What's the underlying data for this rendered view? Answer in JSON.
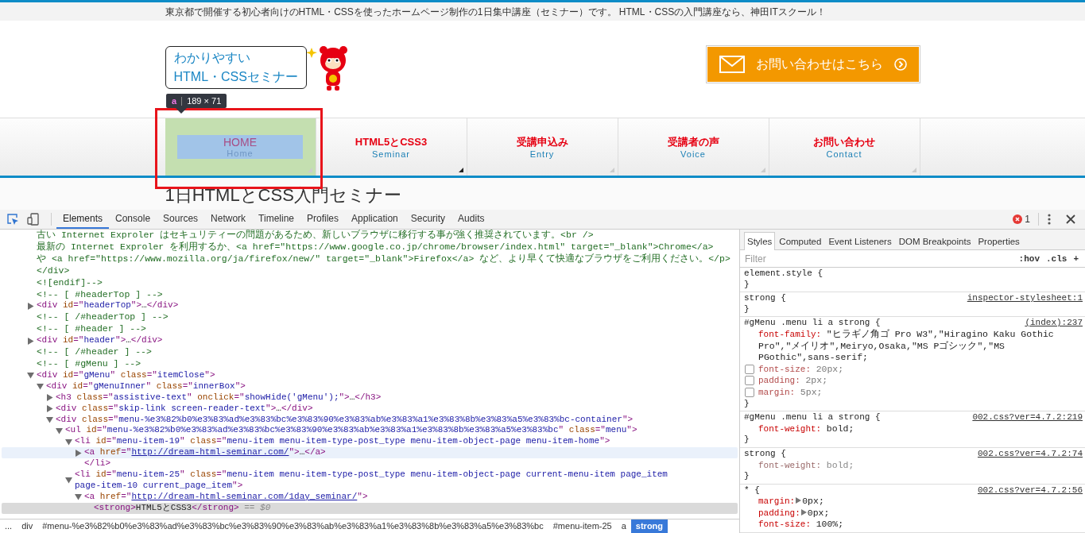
{
  "page": {
    "tagline": "東京都で開催する初心者向けのHTML・CSSを使ったホームページ制作の1日集中講座（セミナー）です。 HTML・CSSの入門講座なら、神田ITスクール！",
    "logo_lines": [
      "わかりやすい",
      "HTML・CSSセミナー"
    ],
    "contact_button": "お問い合わせはこちら",
    "inspect_tooltip": {
      "tag": "a",
      "size": "189 × 71"
    },
    "nav": [
      {
        "label": "HOME",
        "sub": "Home",
        "inspected": true,
        "current": false
      },
      {
        "label": "HTML5とCSS3",
        "sub": "Seminar",
        "inspected": false,
        "current": true
      },
      {
        "label": "受講申込み",
        "sub": "Entry",
        "inspected": false,
        "current": false
      },
      {
        "label": "受講者の声",
        "sub": "Voice",
        "inspected": false,
        "current": false
      },
      {
        "label": "お問い合わせ",
        "sub": "Contact",
        "inspected": false,
        "current": false
      }
    ],
    "heading": "1日HTMLとCSS入門セミナー"
  },
  "devtools": {
    "tabs": [
      {
        "label": "Elements",
        "selected": true
      },
      {
        "label": "Console",
        "selected": false
      },
      {
        "label": "Sources",
        "selected": false
      },
      {
        "label": "Network",
        "selected": false
      },
      {
        "label": "Timeline",
        "selected": false
      },
      {
        "label": "Profiles",
        "selected": false
      },
      {
        "label": "Application",
        "selected": false
      },
      {
        "label": "Security",
        "selected": false
      },
      {
        "label": "Audits",
        "selected": false
      }
    ],
    "error_count": "1",
    "dom": [
      {
        "collapsible": false,
        "hovered": false,
        "selected": false,
        "parts": [
          {
            "kind": "comment",
            "text": "古い Internet Exproler はセキュリティーの問題があるため、新しいブラウザに移行する事が強く推奨されています。<br />"
          }
        ]
      },
      {
        "collapsible": false,
        "hovered": false,
        "selected": false,
        "parts": [
          {
            "kind": "comment",
            "text": "最新の Internet Exproler を利用するか、<a href=\"https://www.google.co.jp/chrome/browser/index.html\" target=\"_blank\">Chrome</a>"
          }
        ]
      },
      {
        "collapsible": false,
        "hovered": false,
        "selected": false,
        "parts": [
          {
            "kind": "comment",
            "text": "や <a href=\"https://www.mozilla.org/ja/firefox/new/\" target=\"_blank\">Firefox</a> など、より早くて快適なブラウザをご利用ください。</p>"
          }
        ]
      },
      {
        "collapsible": false,
        "hovered": false,
        "selected": false,
        "parts": [
          {
            "kind": "comment",
            "text": "</div>"
          }
        ]
      },
      {
        "collapsible": false,
        "hovered": false,
        "selected": false,
        "parts": [
          {
            "kind": "comment",
            "text": "<![endif]-->"
          }
        ]
      },
      {
        "collapsible": false,
        "hovered": false,
        "selected": false,
        "parts": [
          {
            "kind": "comment",
            "text": "<!-- [ #headerTop ] -->"
          }
        ]
      },
      {
        "collapsible": true,
        "expanded": false,
        "hovered": false,
        "selected": false,
        "parts": [
          {
            "kind": "tag",
            "text": "<div"
          },
          {
            "kind": "attr",
            "text": " id"
          },
          {
            "kind": "tag",
            "text": "=\""
          },
          {
            "kind": "value",
            "text": "headerTop"
          },
          {
            "kind": "tag",
            "text": "\">"
          },
          {
            "kind": "ellipsis",
            "text": "…"
          },
          {
            "kind": "tag",
            "text": "</div>"
          }
        ]
      },
      {
        "collapsible": false,
        "hovered": false,
        "selected": false,
        "parts": [
          {
            "kind": "comment",
            "text": "<!-- [ /#headerTop ] -->"
          }
        ]
      },
      {
        "collapsible": false,
        "hovered": false,
        "selected": false,
        "parts": [
          {
            "kind": "comment",
            "text": "<!-- [ #header ] -->"
          }
        ]
      },
      {
        "collapsible": true,
        "expanded": false,
        "hovered": false,
        "selected": false,
        "parts": [
          {
            "kind": "tag",
            "text": "<div"
          },
          {
            "kind": "attr",
            "text": " id"
          },
          {
            "kind": "tag",
            "text": "=\""
          },
          {
            "kind": "value",
            "text": "header"
          },
          {
            "kind": "tag",
            "text": "\">"
          },
          {
            "kind": "ellipsis",
            "text": "…"
          },
          {
            "kind": "tag",
            "text": "</div>"
          }
        ]
      },
      {
        "collapsible": false,
        "hovered": false,
        "selected": false,
        "parts": [
          {
            "kind": "comment",
            "text": "<!-- [ /#header ] -->"
          }
        ]
      },
      {
        "collapsible": false,
        "hovered": false,
        "selected": false,
        "parts": [
          {
            "kind": "comment",
            "text": "<!-- [ #gMenu ] -->"
          }
        ]
      },
      {
        "collapsible": true,
        "expanded": true,
        "hovered": false,
        "selected": false,
        "parts": [
          {
            "kind": "tag",
            "text": "<div"
          },
          {
            "kind": "attr",
            "text": " id"
          },
          {
            "kind": "tag",
            "text": "=\""
          },
          {
            "kind": "value",
            "text": "gMenu"
          },
          {
            "kind": "tag",
            "text": "\""
          },
          {
            "kind": "attr",
            "text": " class"
          },
          {
            "kind": "tag",
            "text": "=\""
          },
          {
            "kind": "value",
            "text": "itemClose"
          },
          {
            "kind": "tag",
            "text": "\">"
          }
        ],
        "children": [
          {
            "collapsible": true,
            "expanded": true,
            "hovered": false,
            "selected": false,
            "parts": [
              {
                "kind": "tag",
                "text": "<div"
              },
              {
                "kind": "attr",
                "text": " id"
              },
              {
                "kind": "tag",
                "text": "=\""
              },
              {
                "kind": "value",
                "text": "gMenuInner"
              },
              {
                "kind": "tag",
                "text": "\""
              },
              {
                "kind": "attr",
                "text": " class"
              },
              {
                "kind": "tag",
                "text": "=\""
              },
              {
                "kind": "value",
                "text": "innerBox"
              },
              {
                "kind": "tag",
                "text": "\">"
              }
            ],
            "children": [
              {
                "collapsible": true,
                "expanded": false,
                "hovered": false,
                "selected": false,
                "parts": [
                  {
                    "kind": "tag",
                    "text": "<h3"
                  },
                  {
                    "kind": "attr",
                    "text": " class"
                  },
                  {
                    "kind": "tag",
                    "text": "=\""
                  },
                  {
                    "kind": "value",
                    "text": "assistive-text"
                  },
                  {
                    "kind": "tag",
                    "text": "\""
                  },
                  {
                    "kind": "attr",
                    "text": " onclick"
                  },
                  {
                    "kind": "tag",
                    "text": "=\""
                  },
                  {
                    "kind": "value",
                    "text": "showHide('gMenu');"
                  },
                  {
                    "kind": "tag",
                    "text": "\">"
                  },
                  {
                    "kind": "ellipsis",
                    "text": "…"
                  },
                  {
                    "kind": "tag",
                    "text": "</h3>"
                  }
                ]
              },
              {
                "collapsible": true,
                "expanded": false,
                "hovered": false,
                "selected": false,
                "parts": [
                  {
                    "kind": "tag",
                    "text": "<div"
                  },
                  {
                    "kind": "attr",
                    "text": " class"
                  },
                  {
                    "kind": "tag",
                    "text": "=\""
                  },
                  {
                    "kind": "value",
                    "text": "skip-link screen-reader-text"
                  },
                  {
                    "kind": "tag",
                    "text": "\">"
                  },
                  {
                    "kind": "ellipsis",
                    "text": "…"
                  },
                  {
                    "kind": "tag",
                    "text": "</div>"
                  }
                ]
              },
              {
                "collapsible": true,
                "expanded": true,
                "hovered": false,
                "selected": false,
                "parts": [
                  {
                    "kind": "tag",
                    "text": "<div"
                  },
                  {
                    "kind": "attr",
                    "text": " class"
                  },
                  {
                    "kind": "tag",
                    "text": "=\""
                  },
                  {
                    "kind": "value",
                    "text": "menu-%e3%82%b0%e3%83%ad%e3%83%bc%e3%83%90%e3%83%ab%e3%83%a1%e3%83%8b%e3%83%a5%e3%83%bc-container"
                  },
                  {
                    "kind": "tag",
                    "text": "\">"
                  }
                ],
                "children": [
                  {
                    "collapsible": true,
                    "expanded": true,
                    "hovered": false,
                    "selected": false,
                    "parts": [
                      {
                        "kind": "tag",
                        "text": "<ul"
                      },
                      {
                        "kind": "attr",
                        "text": " id"
                      },
                      {
                        "kind": "tag",
                        "text": "=\""
                      },
                      {
                        "kind": "value",
                        "text": "menu-%e3%82%b0%e3%83%ad%e3%83%bc%e3%83%90%e3%83%ab%e3%83%a1%e3%83%8b%e3%83%a5%e3%83%bc"
                      },
                      {
                        "kind": "tag",
                        "text": "\""
                      },
                      {
                        "kind": "attr",
                        "text": " class"
                      },
                      {
                        "kind": "tag",
                        "text": "=\""
                      },
                      {
                        "kind": "value",
                        "text": "menu"
                      },
                      {
                        "kind": "tag",
                        "text": "\">"
                      }
                    ],
                    "children": [
                      {
                        "collapsible": true,
                        "expanded": true,
                        "hovered": false,
                        "selected": false,
                        "parts": [
                          {
                            "kind": "tag",
                            "text": "<li"
                          },
                          {
                            "kind": "attr",
                            "text": " id"
                          },
                          {
                            "kind": "tag",
                            "text": "=\""
                          },
                          {
                            "kind": "value",
                            "text": "menu-item-19"
                          },
                          {
                            "kind": "tag",
                            "text": "\""
                          },
                          {
                            "kind": "attr",
                            "text": " class"
                          },
                          {
                            "kind": "tag",
                            "text": "=\""
                          },
                          {
                            "kind": "value",
                            "text": "menu-item menu-item-type-post_type menu-item-object-page menu-item-home"
                          },
                          {
                            "kind": "tag",
                            "text": "\">"
                          }
                        ],
                        "children": [
                          {
                            "collapsible": true,
                            "expanded": false,
                            "hovered": true,
                            "selected": false,
                            "parts": [
                              {
                                "kind": "tag",
                                "text": "<a"
                              },
                              {
                                "kind": "attr",
                                "text": " href"
                              },
                              {
                                "kind": "tag",
                                "text": "=\""
                              },
                              {
                                "kind": "link",
                                "text": "http://dream-html-seminar.com/"
                              },
                              {
                                "kind": "tag",
                                "text": "\">"
                              },
                              {
                                "kind": "ellipsis",
                                "text": "…"
                              },
                              {
                                "kind": "tag",
                                "text": "</a>"
                              }
                            ]
                          },
                          {
                            "collapsible": false,
                            "hovered": false,
                            "selected": false,
                            "parts": [
                              {
                                "kind": "tag",
                                "text": "</li>"
                              }
                            ]
                          }
                        ]
                      },
                      {
                        "collapsible": true,
                        "expanded": true,
                        "hovered": false,
                        "selected": false,
                        "parts": [
                          {
                            "kind": "tag",
                            "text": "<li"
                          },
                          {
                            "kind": "attr",
                            "text": " id"
                          },
                          {
                            "kind": "tag",
                            "text": "=\""
                          },
                          {
                            "kind": "value",
                            "text": "menu-item-25"
                          },
                          {
                            "kind": "tag",
                            "text": "\""
                          },
                          {
                            "kind": "attr",
                            "text": " class"
                          },
                          {
                            "kind": "tag",
                            "text": "=\""
                          },
                          {
                            "kind": "value",
                            "text": "menu-item menu-item-type-post_type menu-item-object-page current-menu-item page_item "
                          },
                          {
                            "kind": "value",
                            "text": "page-item-10 current_page_item"
                          },
                          {
                            "kind": "tag",
                            "text": "\">"
                          }
                        ],
                        "children": [
                          {
                            "collapsible": true,
                            "expanded": true,
                            "hovered": false,
                            "selected": false,
                            "parts": [
                              {
                                "kind": "tag",
                                "text": "<a"
                              },
                              {
                                "kind": "attr",
                                "text": " href"
                              },
                              {
                                "kind": "tag",
                                "text": "=\""
                              },
                              {
                                "kind": "link",
                                "text": "http://dream-html-seminar.com/1day_seminar/"
                              },
                              {
                                "kind": "tag",
                                "text": "\">"
                              }
                            ],
                            "children": [
                              {
                                "collapsible": false,
                                "hovered": false,
                                "selected": true,
                                "parts": [
                                  {
                                    "kind": "tag",
                                    "text": "<strong>"
                                  },
                                  {
                                    "kind": "text",
                                    "text": "HTML5とCSS3"
                                  },
                                  {
                                    "kind": "tag",
                                    "text": "</strong>"
                                  },
                                  {
                                    "kind": "ref",
                                    "text": " == $0"
                                  }
                                ]
                              }
                            ]
                          }
                        ]
                      }
                    ]
                  }
                ]
              }
            ]
          }
        ]
      }
    ],
    "breadcrumbs": {
      "overflow": "...",
      "items": [
        {
          "label": "div",
          "selected": false
        },
        {
          "label": "#menu-%e3%82%b0%e3%83%ad%e3%83%bc%e3%83%90%e3%83%ab%e3%83%a1%e3%83%8b%e3%83%a5%e3%83%bc",
          "selected": false
        },
        {
          "label": "#menu-item-25",
          "selected": false
        },
        {
          "label": "a",
          "selected": false
        },
        {
          "label": "strong",
          "selected": true
        }
      ]
    },
    "styles_tabs": [
      {
        "label": "Styles",
        "selected": true
      },
      {
        "label": "Computed",
        "selected": false
      },
      {
        "label": "Event Listeners",
        "selected": false
      },
      {
        "label": "DOM Breakpoints",
        "selected": false
      },
      {
        "label": "Properties",
        "selected": false
      }
    ],
    "filter": {
      "placeholder": "Filter"
    },
    "filter_buttons": [
      ":hov",
      ".cls",
      "+"
    ],
    "rules": [
      {
        "selector": "element.style {",
        "end": "}"
      },
      {
        "selector": "strong {",
        "source": "inspector-stylesheet:1",
        "end": "}"
      },
      {
        "selector": "#gMenu .menu li a strong {",
        "source": "(index):237",
        "end": "}",
        "properties": [
          {
            "name": "font-family:",
            "value": "\"ヒラギノ角ゴ Pro W3\",\"Hiragino Kaku Gothic Pro\",\"メイリオ\",Meiryo,Osaka,\"MS Pゴシック\",\"MS PGothic\",sans-serif;",
            "enabled": true,
            "overridden": false,
            "expandable": false
          },
          {
            "name": "font-size:",
            "value": "20px;",
            "enabled": false,
            "overridden": false,
            "expandable": false
          },
          {
            "name": "padding:",
            "value": "2px;",
            "enabled": false,
            "overridden": false,
            "expandable": false
          },
          {
            "name": "margin:",
            "value": "5px;",
            "enabled": false,
            "overridden": false,
            "expandable": false
          }
        ]
      },
      {
        "selector": "#gMenu .menu li a strong {",
        "source": "002.css?ver=4.7.2:219",
        "end": "}",
        "properties": [
          {
            "name": "font-weight:",
            "value": "bold;",
            "enabled": true,
            "overridden": false,
            "expandable": false
          }
        ]
      },
      {
        "selector": "strong {",
        "source": "002.css?ver=4.7.2:74",
        "end": "}",
        "properties": [
          {
            "name": "font-weight:",
            "value": "bold;",
            "enabled": true,
            "overridden": true,
            "expandable": false
          }
        ]
      },
      {
        "selector": "* {",
        "source": "002.css?ver=4.7.2:56",
        "properties": [
          {
            "name": "margin:",
            "value": "0px;",
            "enabled": true,
            "overridden": false,
            "expandable": true
          },
          {
            "name": "padding:",
            "value": "0px;",
            "enabled": true,
            "overridden": false,
            "expandable": true
          },
          {
            "name": "font-size:",
            "value": "100%;",
            "enabled": true,
            "overridden": false,
            "expandable": false
          }
        ]
      }
    ]
  }
}
